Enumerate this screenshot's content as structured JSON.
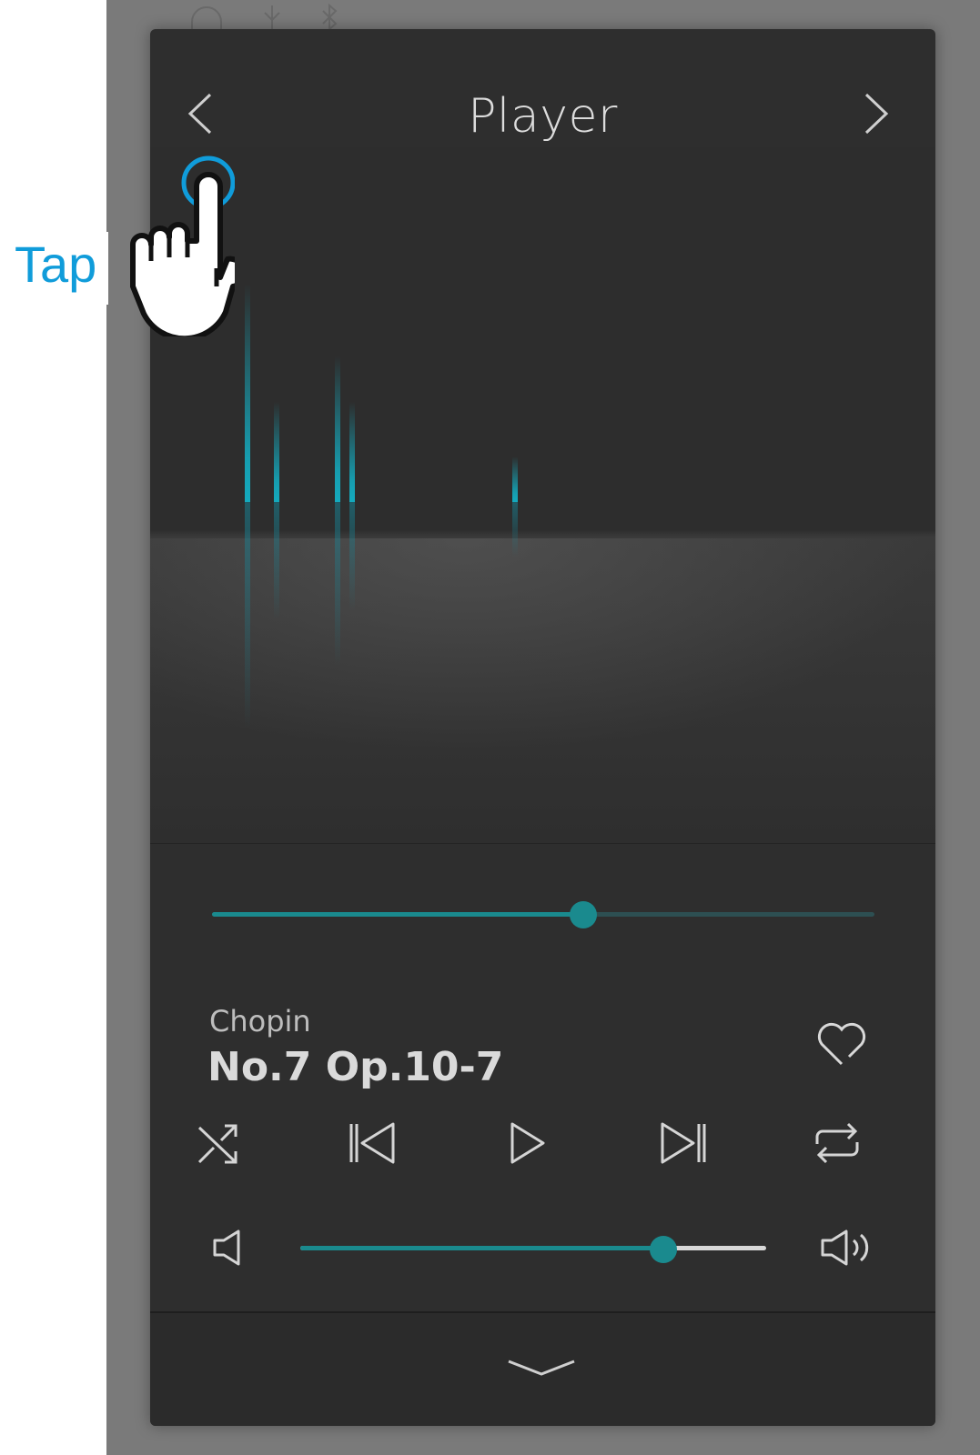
{
  "header": {
    "title": "Player",
    "prev_icon": "chevron-left-icon",
    "next_icon": "chevron-right-icon"
  },
  "status_icons": [
    "headphones-icon",
    "usb-icon",
    "bluetooth-icon"
  ],
  "track": {
    "artist": "Chopin",
    "title": "No.7 Op.10-7",
    "progress_fraction": 0.56
  },
  "favorite_icon": "heart-icon",
  "controls": [
    "shuffle-icon",
    "previous-track-icon",
    "play-icon",
    "next-track-icon",
    "repeat-icon"
  ],
  "volume": {
    "level_fraction": 0.78,
    "low_icon": "volume-low-icon",
    "high_icon": "volume-high-icon"
  },
  "collapse_icon": "chevron-down-icon",
  "annotation": {
    "label": "Tap",
    "color": "#109cda",
    "gesture_icon": "tap-hand-icon"
  },
  "colors": {
    "accent": "#1a8a8e",
    "panel": "#2e2e2e",
    "visualizer_note": "#14aabe"
  }
}
